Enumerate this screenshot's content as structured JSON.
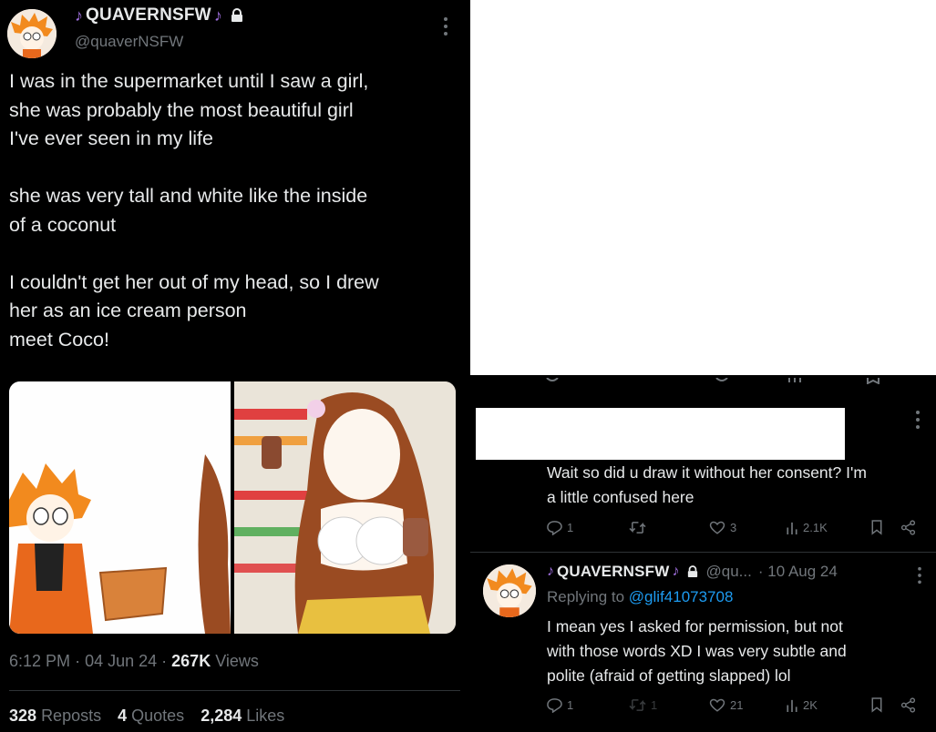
{
  "tweet": {
    "display_name": "QUAVERNSFW",
    "handle": "@quaverNSFW",
    "note_glyph": "♪",
    "body_lines": [
      "I was in the supermarket until I saw a girl,",
      "she was probably the most beautiful girl",
      "I've ever seen in my life",
      "",
      "she was very tall and white like the inside",
      "of a coconut",
      "",
      "I couldn't get her out of my head, so I drew",
      "her as an ice cream person",
      "meet Coco!"
    ],
    "time": "6:12 PM",
    "date": "04 Jun 24",
    "views_count": "267K",
    "views_label": "Views",
    "reposts_count": "328",
    "reposts_label": "Reposts",
    "quotes_count": "4",
    "quotes_label": "Quotes",
    "likes_count": "2,284",
    "likes_label": "Likes"
  },
  "reply1": {
    "text_lines": [
      "Wait so did u draw it without her consent? I'm",
      "a little confused here"
    ],
    "replies": "1",
    "likes": "3",
    "views": "2.1K"
  },
  "reply2": {
    "display_name": "QUAVERNSFW",
    "handle_truncated": "@qu...",
    "date": "· 10 Aug 24",
    "replying_to_label": "Replying to",
    "replying_to_handle": "@glif41073708",
    "text_lines": [
      "I mean yes I asked for permission, but not",
      "with those words XD I was very subtle and",
      "polite (afraid of getting slapped) lol"
    ],
    "replies": "1",
    "reposts": "1",
    "likes": "21",
    "views": "2K"
  },
  "colors": {
    "background": "#000000",
    "text": "#e7e9ea",
    "muted": "#71767b",
    "link": "#1d9bf0",
    "name_note": "#a070e0"
  }
}
